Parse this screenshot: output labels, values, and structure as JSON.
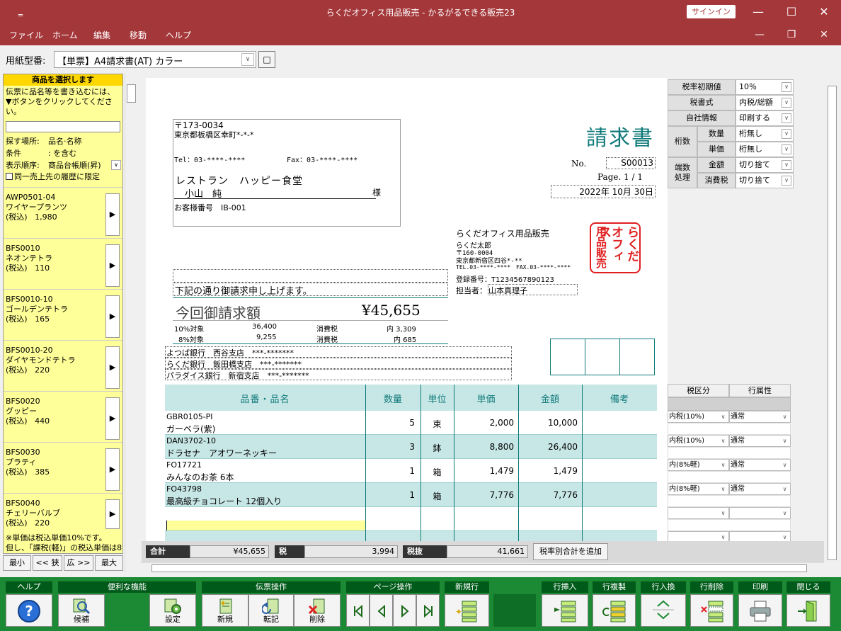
{
  "window": {
    "title": "らくだオフィス用品販売 - かるがるできる販売23",
    "system_glyph": "‗",
    "signin_label": "サインイン",
    "min_glyph": "—",
    "max_glyph": "☐",
    "close_glyph": "✕",
    "restore_glyph": "❐"
  },
  "menu": {
    "items": [
      "ファイル",
      "ホーム",
      "編集",
      "移動",
      "ヘルプ"
    ]
  },
  "paper_select": {
    "label": "用紙型番:",
    "value": "【単票】A4請求書(AT) カラー",
    "dropdown_glyph": "∨",
    "button_glyph": "□"
  },
  "left_panel": {
    "header": "商品を選択します",
    "hint_1": "伝票に品名等を書き込むには、",
    "hint_2": "▼ボタンをクリックしてください。",
    "search_value": "",
    "filters": [
      {
        "label": "探す場所:",
        "value": "品名·名称"
      },
      {
        "label": "条件",
        "value": ": を含む"
      },
      {
        "label": "表示順序:",
        "value": "商品台帳順(昇)"
      }
    ],
    "checkbox_label": "同一売上先の履歴に限定",
    "items": [
      {
        "code": "AWP0501-04",
        "name": "ワイヤープランツ",
        "tax": "(税込)",
        "price": "1,980"
      },
      {
        "code": "BFS0010",
        "name": "ネオンテトラ",
        "tax": "(税込)",
        "price": "110"
      },
      {
        "code": "BFS0010-10",
        "name": "ゴールデンテトラ",
        "tax": "(税込)",
        "price": "165"
      },
      {
        "code": "BFS0010-20",
        "name": "ダイヤモンドテトラ",
        "tax": "(税込)",
        "price": "220"
      },
      {
        "code": "BFS0020",
        "name": "グッピー",
        "tax": "(税込)",
        "price": "440"
      },
      {
        "code": "BFS0030",
        "name": "プラティ",
        "tax": "(税込)",
        "price": "385"
      },
      {
        "code": "BFS0040",
        "name": "チェリーバルブ",
        "tax": "(税込)",
        "price": "220"
      }
    ],
    "arrow_glyph": "▶",
    "footnote_1": "※単価は税込単価10%です。",
    "footnote_2": "但し、「課税(軽)」の税込単価は8%",
    "nav": [
      "最小",
      "<< 狭",
      "広 >>",
      "最大"
    ]
  },
  "invoice": {
    "postal": "〒173-0034",
    "address": "東京都板橋区幸町*-*-*",
    "tel": "Tel：03-****-****",
    "fax": "Fax：03-****-****",
    "customer_name": "レストラン　ハッピー食堂",
    "contact": "小山　純",
    "honorific": "様",
    "customer_no": "お客様番号　IB-001",
    "title": "請求書",
    "no_label": "No.",
    "no_value": "S00013",
    "page": "Page. 1 / 1",
    "date": "2022年 10月 30日",
    "company": "らくだオフィス用品販売",
    "rep": "らくだ太郎",
    "co_postal": "〒160-0004",
    "co_address": "東京都新宿区四谷*-**",
    "co_telfax": "TEL.03-****-****　FAX.03-****-****",
    "reg_no": "登録番号：T1234567890123",
    "staff_label": "担当者：",
    "staff": "山本真理子",
    "stamp": [
      "らく",
      "オフ",
      "用品"
    ],
    "stamp_lines": [
      "らくだ",
      "オフィス",
      "用品販売"
    ],
    "message": "下記の通り御請求申し上げます。",
    "amount_label": "今回御請求額",
    "amount": "¥45,655",
    "tax10_label": "10%対象",
    "tax10_base": "36,400",
    "tax10_tax_label": "消費税",
    "tax10_tax": "内 3,309",
    "tax8_label": "8%対象",
    "tax8_base": "9,255",
    "tax8_tax_label": "消費税",
    "tax8_tax": "内 685",
    "banks": [
      "よつば銀行　西谷支店　***-*******",
      "らくだ銀行　飯田橋支店　***-*******",
      "パラダイス銀行　新宿支店　***-*******"
    ],
    "columns": [
      "品番・品名",
      "数量",
      "単位",
      "単価",
      "金額",
      "備考"
    ],
    "rows": [
      {
        "code": "GBR0105-PI",
        "name": "ガーベラ(紫)",
        "qty": "5",
        "unit": "束",
        "price": "2,000",
        "amount": "10,000"
      },
      {
        "code": "DAN3702-10",
        "name": "ドラセナ　アオワーネッキー",
        "qty": "3",
        "unit": "鉢",
        "price": "8,800",
        "amount": "26,400"
      },
      {
        "code": "FO17721",
        "name": "みんなのお茶 6本",
        "qty": "1",
        "unit": "箱",
        "price": "1,479",
        "amount": "1,479"
      },
      {
        "code": "FO43798",
        "name": "最高級チョコレート 12個入り",
        "qty": "1",
        "unit": "箱",
        "price": "7,776",
        "amount": "7,776"
      }
    ]
  },
  "settings": {
    "rows": [
      {
        "label": "税率初期値",
        "value": "10％"
      },
      {
        "label": "税書式",
        "value": "内税/総額"
      },
      {
        "label": "自社情報",
        "value": "印刷する"
      }
    ],
    "digits_label": "桁数",
    "digits": [
      {
        "label": "数量",
        "value": "桁無し"
      },
      {
        "label": "単価",
        "value": "桁無し"
      }
    ],
    "rounding_label_1": "端数",
    "rounding_label_2": "処理",
    "rounding": [
      {
        "label": "金額",
        "value": "切り捨て"
      },
      {
        "label": "消費税",
        "value": "切り捨て"
      }
    ],
    "line_headers": [
      "税区分",
      "行属性"
    ],
    "line_rows": [
      {
        "tax": "内税(10%)",
        "attr": "通常"
      },
      {
        "tax": "内税(10%)",
        "attr": "通常"
      },
      {
        "tax": "内(8%軽)",
        "attr": "通常"
      },
      {
        "tax": "内(8%軽)",
        "attr": "通常"
      }
    ]
  },
  "totals": {
    "total_label": "合計",
    "total_value": "¥45,655",
    "tax_label": "税",
    "tax_value": "3,994",
    "excl_label": "税抜",
    "excl_value": "41,661",
    "add_button": "税率別合計を追加"
  },
  "toolbar": {
    "groups": {
      "help": "ヘルプ",
      "useful": "便利な機能",
      "slip": "伝票操作",
      "page": "ページ操作",
      "newrow": "新規行",
      "insert": "行挿入",
      "copy": "行複製",
      "swap": "行入換",
      "delete": "行削除",
      "print": "印刷",
      "close": "閉じる"
    },
    "buttons": {
      "candidate": "候補",
      "setting": "設定",
      "new": "新規",
      "transfer": "転記",
      "remove": "削除"
    }
  },
  "colors": {
    "titlebar": "#a4373a",
    "toolbar": "#1c8a34",
    "teal": "#107a7a",
    "panel_yellow": "#ffff99",
    "stamp_red": "#e02020"
  }
}
